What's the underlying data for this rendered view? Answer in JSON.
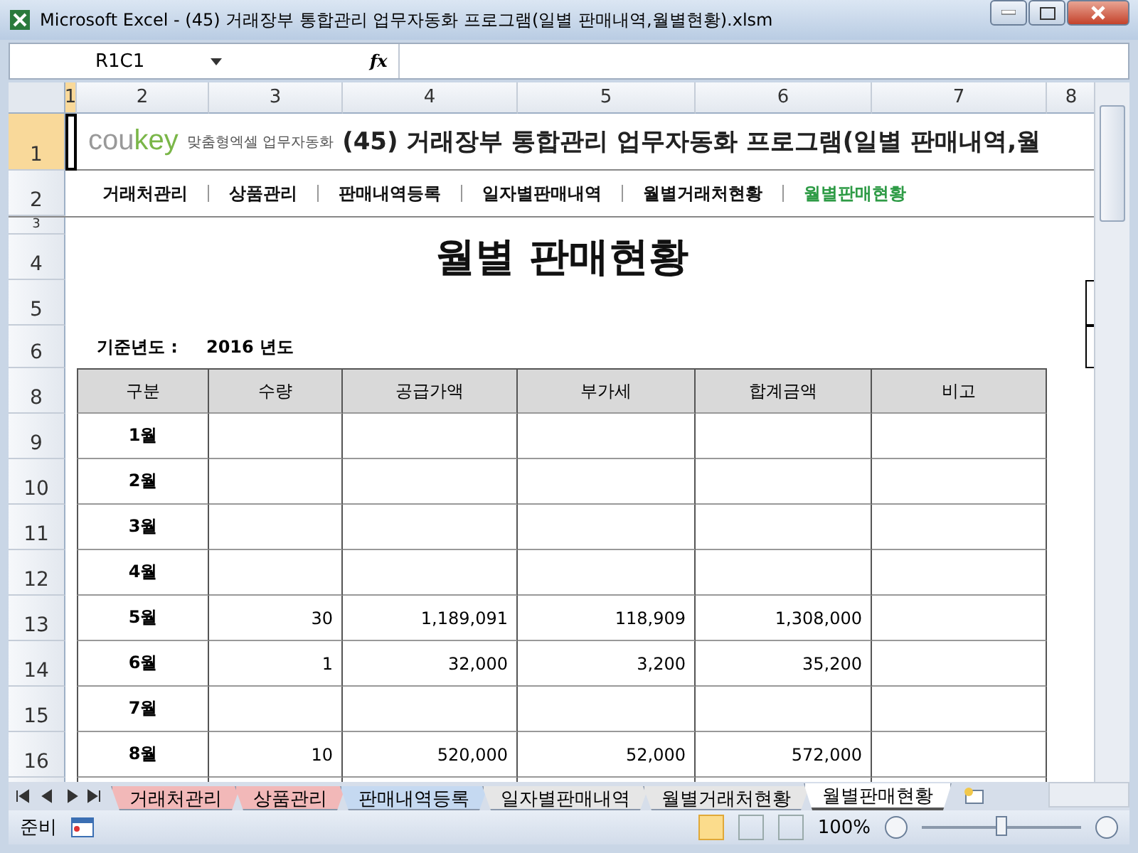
{
  "window": {
    "title": "Microsoft Excel - (45) 거래장부 통합관리 업무자동화 프로그램(일별 판매내역,월별현황).xlsm"
  },
  "name_box": "R1C1",
  "function_button": "fx",
  "column_headers": [
    {
      "label": "1",
      "selected": true
    },
    {
      "label": "2",
      "selected": false
    },
    {
      "label": "3",
      "selected": false
    },
    {
      "label": "4",
      "selected": false
    },
    {
      "label": "5",
      "selected": false
    },
    {
      "label": "6",
      "selected": false
    },
    {
      "label": "7",
      "selected": false
    },
    {
      "label": "8",
      "selected": false
    }
  ],
  "row_headers": [
    {
      "label": "1",
      "selected": true
    },
    {
      "label": "2",
      "selected": false
    },
    {
      "label": "3",
      "selected": false
    },
    {
      "label": "4",
      "selected": false
    },
    {
      "label": "5",
      "selected": false
    },
    {
      "label": "6",
      "selected": false
    },
    {
      "label": "8",
      "selected": false
    },
    {
      "label": "9",
      "selected": false
    },
    {
      "label": "10",
      "selected": false
    },
    {
      "label": "11",
      "selected": false
    },
    {
      "label": "12",
      "selected": false
    },
    {
      "label": "13",
      "selected": false
    },
    {
      "label": "14",
      "selected": false
    },
    {
      "label": "15",
      "selected": false
    },
    {
      "label": "16",
      "selected": false
    }
  ],
  "logo": {
    "brand_a": "cou",
    "brand_b": "key",
    "tagline": "맞춤형엑셀 업무자동화"
  },
  "sheet_title": "(45) 거래장부 통합관리 업무자동화 프로그램(일별 판매내역,월",
  "nav": [
    {
      "label": "거래처관리",
      "selected": false
    },
    {
      "label": "상품관리",
      "selected": false
    },
    {
      "label": "판매내역등록",
      "selected": false
    },
    {
      "label": "일자별판매내역",
      "selected": false
    },
    {
      "label": "월별거래처현황",
      "selected": false
    },
    {
      "label": "월별판매현황",
      "selected": true
    }
  ],
  "heading": "월별 판매현황",
  "base_year": {
    "label": "기준년도 :",
    "value": "2016 년도"
  },
  "table": {
    "columns": [
      "구분",
      "수량",
      "공급가액",
      "부가세",
      "합계금액",
      "비고"
    ],
    "rows": [
      [
        "1월",
        "",
        "",
        "",
        "",
        ""
      ],
      [
        "2월",
        "",
        "",
        "",
        "",
        ""
      ],
      [
        "3월",
        "",
        "",
        "",
        "",
        ""
      ],
      [
        "4월",
        "",
        "",
        "",
        "",
        ""
      ],
      [
        "5월",
        "30",
        "1,189,091",
        "118,909",
        "1,308,000",
        ""
      ],
      [
        "6월",
        "1",
        "32,000",
        "3,200",
        "35,200",
        ""
      ],
      [
        "7월",
        "",
        "",
        "",
        "",
        ""
      ],
      [
        "8월",
        "10",
        "520,000",
        "52,000",
        "572,000",
        ""
      ]
    ]
  },
  "sheet_tabs": [
    {
      "label": "거래처관리",
      "selected": false,
      "color": "#f2b8b8"
    },
    {
      "label": "상품관리",
      "selected": false,
      "color": "#f2b8b8"
    },
    {
      "label": "판매내역등록",
      "selected": false,
      "color": "#c5d9f1"
    },
    {
      "label": "일자별판매내역",
      "selected": false,
      "color": "#e6e6e6"
    },
    {
      "label": "월별거래처현황",
      "selected": false,
      "color": "#e6e6e6"
    },
    {
      "label": "월별판매현황",
      "selected": true,
      "color": "#ffffff"
    }
  ],
  "status": "준비",
  "zoom": {
    "reading": "100%",
    "level": 0.5
  }
}
